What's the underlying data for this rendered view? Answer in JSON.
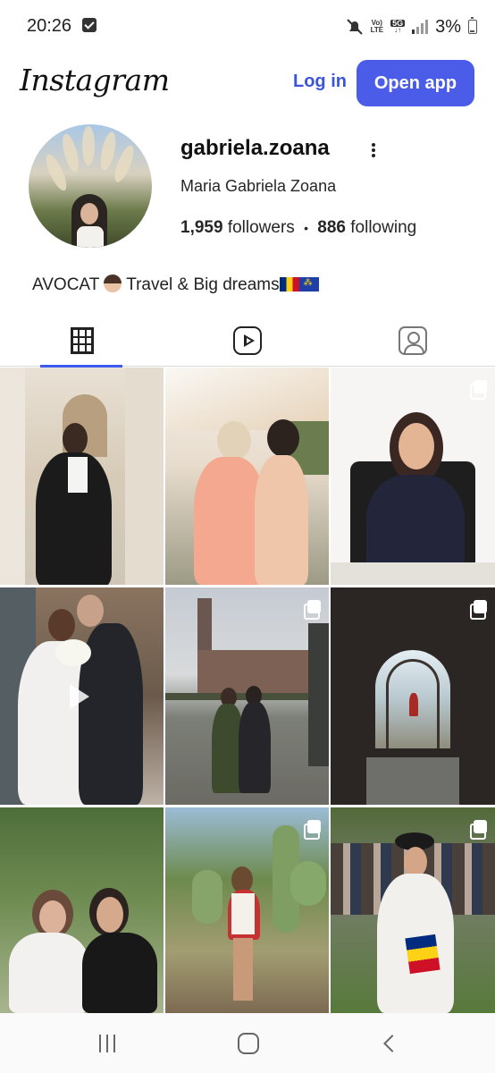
{
  "status_bar": {
    "time": "20:26",
    "network_top": "Vo)",
    "network_bottom": "LTE",
    "network_5g": "5G",
    "battery_percent": "3%",
    "icons": [
      "check-notification-icon",
      "mute-icon",
      "signal-icon",
      "battery-icon"
    ]
  },
  "header": {
    "logo": "Instagram",
    "login_label": "Log in",
    "open_app_label": "Open app",
    "accent_color": "#4b5ce8"
  },
  "profile": {
    "username": "gabriela.zoana",
    "full_name": "Maria Gabriela Zoana",
    "followers_count": "1,959",
    "followers_label": "followers",
    "separator": "•",
    "following_count": "886",
    "following_label": "following",
    "bio_text_1": "AVOCAT",
    "bio_text_2": "Travel & Big dreams"
  },
  "tabs": [
    {
      "name": "posts",
      "icon": "grid-icon",
      "active": true
    },
    {
      "name": "reels",
      "icon": "reels-icon",
      "active": false
    },
    {
      "name": "tagged",
      "icon": "tagged-icon",
      "active": false
    }
  ],
  "posts": [
    {
      "id": 1,
      "multi": false
    },
    {
      "id": 2,
      "multi": true
    },
    {
      "id": 3,
      "multi": true
    },
    {
      "id": 4,
      "multi": false,
      "video": true
    },
    {
      "id": 5,
      "multi": true
    },
    {
      "id": 6,
      "multi": true
    },
    {
      "id": 7,
      "multi": false
    },
    {
      "id": 8,
      "multi": true
    },
    {
      "id": 9,
      "multi": true
    }
  ],
  "navbar": {
    "icons": [
      "recents-icon",
      "home-icon",
      "back-icon"
    ]
  }
}
